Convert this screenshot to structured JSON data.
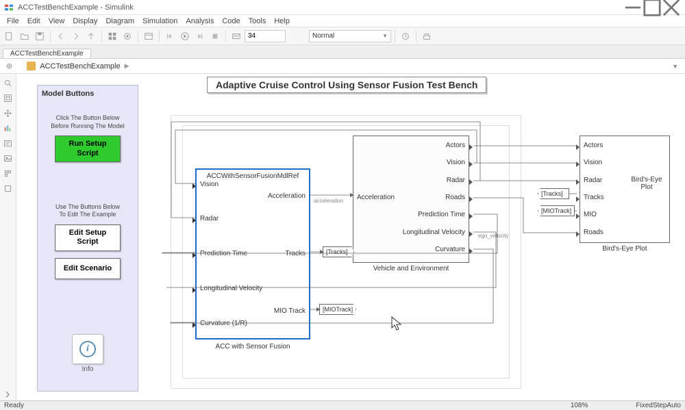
{
  "window": {
    "title": "ACCTestBenchExample - Simulink"
  },
  "menu": [
    "File",
    "Edit",
    "View",
    "Display",
    "Diagram",
    "Simulation",
    "Analysis",
    "Code",
    "Tools",
    "Help"
  ],
  "toolbar": {
    "stop_time": "34",
    "mode": "Normal"
  },
  "tabs": [
    "ACCTestBenchExample"
  ],
  "breadcrumb": {
    "root": "ACCTestBenchExample"
  },
  "diagram": {
    "title": "Adaptive Cruise Control Using Sensor Fusion Test Bench",
    "model_buttons": {
      "panel_title": "Model Buttons",
      "hint1a": "Click The Button Below",
      "hint1b": "Before Running The Model",
      "run_setup": "Run Setup Script",
      "hint2a": "Use The Buttons Below",
      "hint2b": "To Edit The Example",
      "edit_setup": "Edit Setup Script",
      "edit_scenario": "Edit Scenario",
      "info": "Info"
    },
    "acc": {
      "ref": "ACCWithSensorFusionMdlRef",
      "caption": "ACC with Sensor Fusion",
      "in": [
        "Vision",
        "Radar",
        "Prediction Time",
        "Longitudinal Velocity",
        "Curvature (1/R)"
      ],
      "out": [
        "Acceleration",
        "Tracks",
        "MIO Track"
      ]
    },
    "ve": {
      "caption": "Vehicle and Environment",
      "out": [
        "Actors",
        "Vision",
        "Radar",
        "Roads",
        "Prediction Time",
        "Longitudinal Velocity",
        "Curvature"
      ],
      "in": [
        "Acceleration"
      ]
    },
    "beb": {
      "caption": "Bird's-Eye Plot",
      "center": "Bird's-Eye Plot",
      "in": [
        "Actors",
        "Vision",
        "Radar",
        "Tracks",
        "MIO",
        "Roads"
      ]
    },
    "tags": {
      "tracks": "[Tracks]",
      "miotrack": "[MIOTrack]"
    },
    "signals": {
      "acceleration": "acceleration",
      "ego_velocity": "ego_velocity"
    }
  },
  "status": {
    "left": "Ready",
    "zoom": "108%",
    "solver": "FixedStepAuto"
  }
}
